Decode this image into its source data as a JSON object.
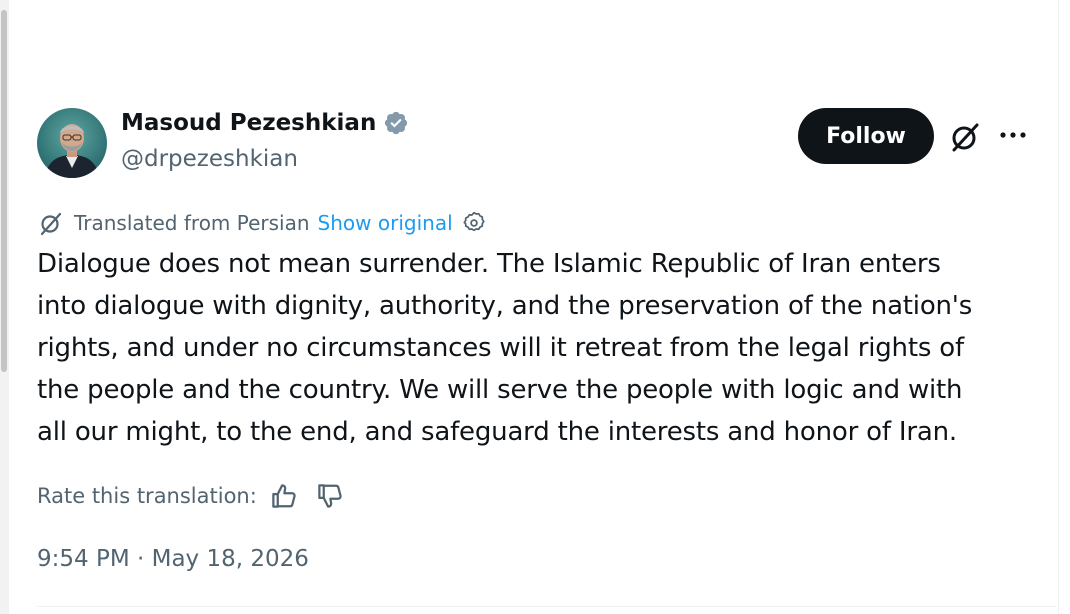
{
  "author": {
    "name": "Masoud Pezeshkian",
    "handle": "@drpezeshkian",
    "verified_icon": "verified-badge-icon",
    "verified_color": "#829aab"
  },
  "actions": {
    "follow_label": "Follow",
    "grok_icon": "grok-icon",
    "more_icon": "more-icon"
  },
  "translation": {
    "icon": "translate-icon",
    "label": "Translated from Persian",
    "show_original": "Show original",
    "settings_icon": "settings-icon"
  },
  "tweet": {
    "lines": [
      "Dialogue does not mean surrender. The Islamic Republic of Iran enters",
      "into dialogue with dignity, authority, and the preservation of the nation's",
      "rights, and under no circumstances will it retreat from the legal rights of",
      "the people and the country. We will serve the people with logic and with",
      "all our might, to the end, and safeguard the interests and honor of Iran."
    ]
  },
  "rating": {
    "label": "Rate this translation:",
    "up_icon": "thumbs-up-icon",
    "down_icon": "thumbs-down-icon"
  },
  "timestamp": "9:54 PM · May 18, 2026",
  "colors": {
    "text": "#0f1419",
    "secondary": "#536471",
    "link": "#1d9bf0",
    "button_bg": "#0f1419"
  }
}
